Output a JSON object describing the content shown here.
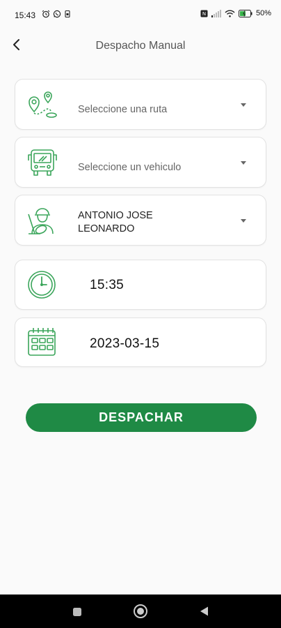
{
  "status_bar": {
    "time": "15:43",
    "battery_percent": "50%",
    "icons_left": [
      "alarm-icon",
      "whatsapp-icon",
      "sim-icon"
    ],
    "icons_right": [
      "nfc-icon",
      "signal-icon",
      "wifi-icon",
      "battery-icon"
    ]
  },
  "header": {
    "title": "Despacho Manual",
    "back_icon": "back-chevron-icon"
  },
  "form": {
    "route": {
      "placeholder": "Seleccione una ruta",
      "icon": "route-map-pin-icon"
    },
    "vehicle": {
      "placeholder": "Seleccione un vehiculo",
      "icon": "bus-icon"
    },
    "driver": {
      "value_line1": "ANTONIO JOSE",
      "value_line2": "LEONARDO",
      "icon": "driver-icon"
    },
    "time": {
      "value": "15:35",
      "icon": "clock-icon"
    },
    "date": {
      "value": "2023-03-15",
      "icon": "calendar-icon"
    }
  },
  "actions": {
    "dispatch_label": "DESPACHAR"
  },
  "colors": {
    "accent": "#1f8a45",
    "icon_green": "#3aa55a"
  },
  "nav_bar": {
    "buttons": [
      "recent-apps-icon",
      "home-icon",
      "back-triangle-icon"
    ]
  }
}
